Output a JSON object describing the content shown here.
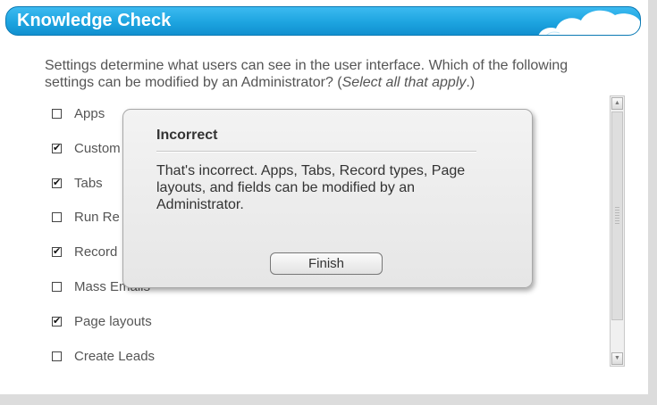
{
  "header": {
    "title": "Knowledge Check"
  },
  "question": {
    "text": "Settings determine what users can see in the user interface. Which of the following settings can be modified by an Administrator? (",
    "hint": "Select all that apply",
    "end": ".)"
  },
  "options": [
    {
      "label": "Apps",
      "checked": false
    },
    {
      "label": "Custom",
      "checked": true
    },
    {
      "label": "Tabs",
      "checked": true
    },
    {
      "label": "Run Re",
      "checked": false
    },
    {
      "label": "Record",
      "checked": true
    },
    {
      "label": "Mass Emails",
      "checked": false
    },
    {
      "label": "Page layouts",
      "checked": true
    },
    {
      "label": "Create Leads",
      "checked": false
    }
  ],
  "feedback": {
    "title": "Incorrect",
    "message": "That's incorrect. Apps, Tabs, Record types, Page layouts, and fields can be modified by an Administrator.",
    "button": "Finish"
  },
  "icons": {
    "checkbox_checked": "check-mark-icon",
    "scroll_up": "arrow-up-icon",
    "scroll_down": "arrow-down-icon",
    "cloud": "cloud-icon"
  },
  "colors": {
    "header": "#1da4e0",
    "text": "#555555"
  }
}
